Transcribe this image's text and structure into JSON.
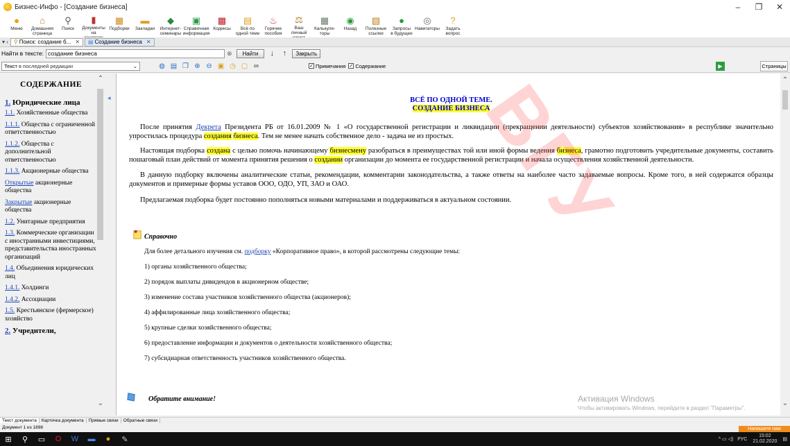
{
  "window": {
    "title": "Бизнес-Инфо - [Создание бизнеса]",
    "controls": [
      "–",
      "❐",
      "✕"
    ]
  },
  "toolbar": [
    {
      "label": "Меню",
      "icon": "menu-icon",
      "glyph": "●",
      "color": "#e8a000"
    },
    {
      "label": "Домашняя\nстраница",
      "icon": "home-icon",
      "glyph": "⌂",
      "color": "#c07a20"
    },
    {
      "label": "Поиск",
      "icon": "search-icon",
      "glyph": "⚲",
      "color": "#555"
    },
    {
      "label": "Документы\nна контроле",
      "icon": "documents-control-icon",
      "glyph": "▮",
      "color": "#c03030"
    },
    {
      "label": "Подборки",
      "icon": "collections-icon",
      "glyph": "▦",
      "color": "#d08a20"
    },
    {
      "label": "Закладки",
      "icon": "bookmarks-icon",
      "glyph": "▬",
      "color": "#e0a020"
    },
    {
      "label": "Интернет-\nсеминары",
      "icon": "webinars-icon",
      "glyph": "◆",
      "color": "#2a8a3a"
    },
    {
      "label": "Справочная\nинформация",
      "icon": "reference-icon",
      "glyph": "▣",
      "color": "#2a9a4a"
    },
    {
      "label": "Кодексы",
      "icon": "codes-icon",
      "glyph": "▩",
      "color": "#c0202a"
    },
    {
      "label": "Всё по\nодной теме",
      "icon": "one-topic-icon",
      "glyph": "▤",
      "color": "#e0a020"
    },
    {
      "label": "Горячие\nпособия",
      "icon": "hot-guides-icon",
      "glyph": "♨",
      "color": "#c03030"
    },
    {
      "label": "Ваш личный\nюрист",
      "icon": "lawyer-icon",
      "glyph": "⚖",
      "color": "#b08030"
    },
    {
      "label": "Калькуля-\nторы",
      "icon": "calculator-icon",
      "glyph": "▦",
      "color": "#6a7a6a"
    },
    {
      "label": "Назад",
      "icon": "back-icon",
      "glyph": "◉",
      "color": "#2a9a3a"
    },
    {
      "label": "Полезные\nссылки",
      "icon": "useful-links-icon",
      "glyph": "▧",
      "color": "#c08020"
    },
    {
      "label": "Запросы\nв будущее",
      "icon": "future-requests-icon",
      "glyph": "●",
      "color": "#2a9a3a"
    },
    {
      "label": "Навигаторы",
      "icon": "navigators-icon",
      "glyph": "◎",
      "color": "#666"
    },
    {
      "label": "Задать\nвопрос",
      "icon": "ask-question-icon",
      "glyph": "?",
      "color": "#e0a020"
    }
  ],
  "tabs": {
    "items": [
      {
        "label": "Поиск: создание б...",
        "active": false
      },
      {
        "label": "Создание бизнеса",
        "active": true
      }
    ]
  },
  "search": {
    "label": "Найти в тексте:",
    "value": "создание бизнеса",
    "find_label": "Найти",
    "close_label": "Закрыть"
  },
  "view": {
    "edition_label": "Текст",
    "edition_value": "в последней редакции",
    "notes_label": "Примечания",
    "contents_label": "Содержание",
    "pages_label": "Страницы"
  },
  "sidebar": {
    "heading": "СОДЕРЖАНИЕ",
    "sections": [
      {
        "num": "1.",
        "title": " Юридические лица",
        "items": [
          {
            "num": "1.1.",
            "text": " Хозяйственные общества"
          },
          {
            "num": "1.1.1.",
            "text": " Общества с ограниченной ответственностью"
          },
          {
            "num": "1.1.2.",
            "text": " Общества с дополнительной ответственностью"
          },
          {
            "num": "1.1.3.",
            "text": " Акционерные общества"
          },
          {
            "num": "Открытые",
            "text": " акционерные общества"
          },
          {
            "num": "Закрытые",
            "text": " акционерные общества"
          },
          {
            "num": "1.2.",
            "text": " Унитарные предприятия"
          },
          {
            "num": "1.3.",
            "text": " Коммерческие организации с иностранными инвестициями, представительства иностранных организаций"
          },
          {
            "num": "1.4.",
            "text": " Объединения юридических лиц"
          },
          {
            "num": "1.4.1.",
            "text": " Холдинги"
          },
          {
            "num": "1.4.2.",
            "text": " Ассоциации"
          },
          {
            "num": "1.5.",
            "text": " Крестьянское (фермерское) хозяйство"
          }
        ]
      },
      {
        "num": "2.",
        "title": " Учредители,",
        "items": []
      }
    ]
  },
  "document": {
    "title_line1": "ВСЁ ПО ОДНОЙ ТЕМЕ.",
    "title_line2": "СОЗДАНИЕ БИЗНЕСА",
    "p1": {
      "a": "После принятия ",
      "link": "Декрета",
      "b": " Президента РБ от 16.01.2009 № 1 «О государственной регистрации и ликвидации (прекращении деятельности) субъектов хозяйствования» в республике значительно упростилась процедура ",
      "h1": "создания",
      "c": " ",
      "h2": "бизнеса",
      "d": ". Тем не менее начать собственное дело - задача не из простых."
    },
    "p2": {
      "a": "Настоящая подборка ",
      "h1": "создана",
      "b": " с целью помочь начинающему ",
      "h2": "бизнесмену",
      "c": " разобраться в преимуществах той или иной формы ведения ",
      "h3": "бизнеса",
      "d": ", грамотно подготовить учредительные документы, составить пошаговый план действий от момента принятия решения о ",
      "h4": "создании",
      "e": " организации до момента ее государственной регистрации и начала осуществления хозяйственной деятельности."
    },
    "p3": "В данную подборку включены аналитические статьи, рекомендации, комментарии законодательства, а также ответы на наиболее часто задаваемые вопросы. Кроме того, в ней содержатся образцы документов и примерные формы уставов ООО, ОДО, УП, ЗАО и ОАО.",
    "p4": "Предлагаемая подборка будет постоянно пополняться новыми материалами и поддерживаться в актуальном состоянии.",
    "note": {
      "title": "Справочно",
      "intro_a": "Для более детального изучения см. ",
      "intro_link": "подборку",
      "intro_b": " «Корпоративное право», в которой рассмотрены следующие темы:",
      "topics": [
        "1) органы хозяйственного общества;",
        "2) порядок выплаты дивидендов в акционерном обществе;",
        "3) изменение состава участников хозяйственного общества (акционеров);",
        "4) аффилированные лица хозяйственного общества;",
        "5) крупные сделки хозяйственного общества;",
        "6) предоставление информации и документов о деятельности хозяйственного общества;",
        "7) субсидиарная ответственность участников хозяйственного общества."
      ]
    },
    "note2_title": "Обратите внимание!"
  },
  "activation": {
    "line1": "Активация Windows",
    "line2": "Чтобы активировать Windows, перейдите в раздел \"Параметры\"."
  },
  "watermark_text": "ВГУ",
  "bottom_tabs": [
    "Текст документа",
    "Карточка документа",
    "Прямые связи",
    "Обратные связи"
  ],
  "status": {
    "doc_counter": "Документ 1 из 1898",
    "write_us": "Напишите нам"
  },
  "taskbar": {
    "lang": "РУС",
    "time": "15:02",
    "date": "21.02.2020"
  }
}
